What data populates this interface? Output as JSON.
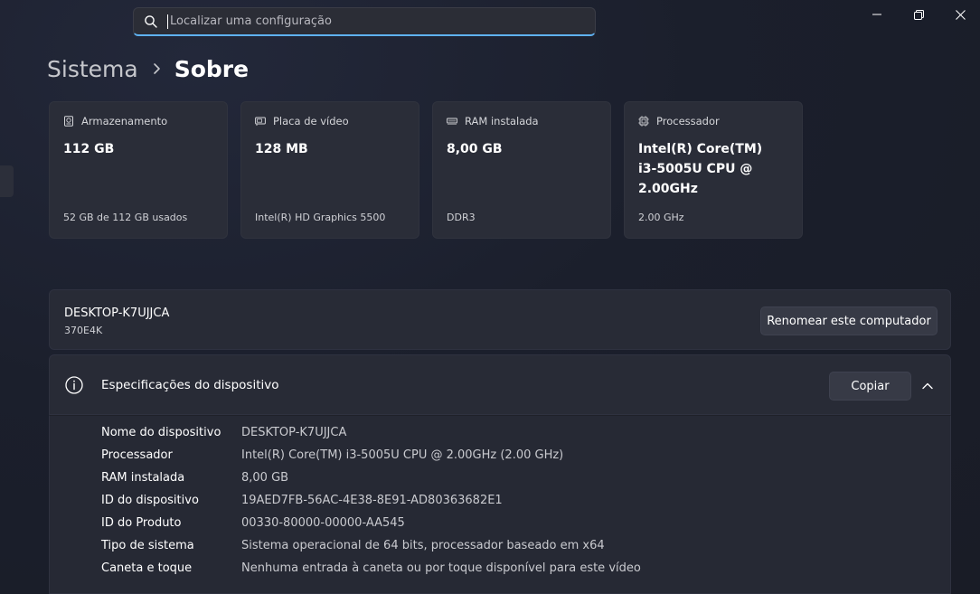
{
  "search": {
    "placeholder": "Localizar uma configuração"
  },
  "breadcrumb": {
    "parent": "Sistema",
    "current": "Sobre"
  },
  "tiles": [
    {
      "icon": "storage-icon",
      "label": "Armazenamento",
      "value": "112 GB",
      "sub": "52 GB de 112 GB usados"
    },
    {
      "icon": "gpu-icon",
      "label": "Placa de vídeo",
      "value": "128 MB",
      "sub": "Intel(R) HD Graphics 5500"
    },
    {
      "icon": "ram-icon",
      "label": "RAM instalada",
      "value": "8,00 GB",
      "sub": "DDR3"
    },
    {
      "icon": "cpu-icon",
      "label": "Processador",
      "value_lines": [
        "Intel(R) Core(TM)",
        "i3-5005U CPU @",
        "2.00GHz"
      ],
      "sub": "2.00 GHz"
    }
  ],
  "device": {
    "name": "DESKTOP-K7UJJCA",
    "model": "370E4K",
    "rename_label": "Renomear este computador"
  },
  "specs": {
    "title": "Especificações do dispositivo",
    "copy_label": "Copiar",
    "rows": [
      {
        "label": "Nome do dispositivo",
        "value": "DESKTOP-K7UJJCA"
      },
      {
        "label": "Processador",
        "value": "Intel(R) Core(TM) i3-5005U CPU @ 2.00GHz (2.00 GHz)"
      },
      {
        "label": "RAM instalada",
        "value": "8,00 GB"
      },
      {
        "label": "ID do dispositivo",
        "value": "19AED7FB-56AC-4E38-8E91-AD80363682E1"
      },
      {
        "label": "ID do Produto",
        "value": "00330-80000-00000-AA545"
      },
      {
        "label": "Tipo de sistema",
        "value": "Sistema operacional de 64 bits, processador baseado em x64"
      },
      {
        "label": "Caneta e toque",
        "value": "Nenhuma entrada à caneta ou por toque disponível para este vídeo"
      }
    ]
  },
  "colors": {
    "accent": "#5fb2f2",
    "card": "#2a2d38",
    "background": "#1b1f2c"
  }
}
